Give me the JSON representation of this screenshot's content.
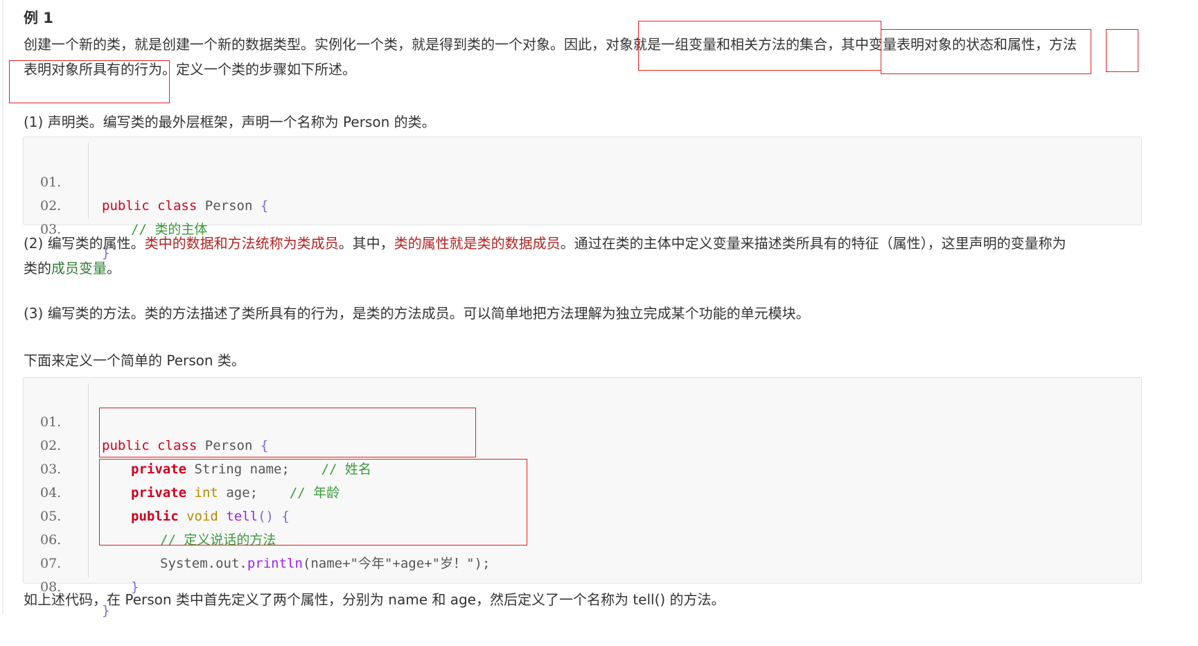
{
  "heading": "例 1",
  "intro": {
    "part1": "创建一个新的类，就是创建一个新的数据类型。实例化一个类，就是得到类的一个对象。因此，",
    "part2": "对象就是一组变量和相关方法的集合",
    "sep1": "，",
    "part3": "其中变量表明对象的状态和属性",
    "sep2": "，",
    "part4": "方法",
    "part5": "表明对象所具有的行为",
    "part6": "。定义一个类的步骤如下所述。"
  },
  "step1": "(1) 声明类。编写类的最外层框架，声明一个名称为 Person 的类。",
  "code1": {
    "line_numbers": [
      "01.",
      "02.",
      "03."
    ],
    "l1": {
      "kw1": "public",
      "kw2": "class",
      "name": "Person",
      "brace": "{"
    },
    "l2": {
      "comment": "// 类的主体"
    },
    "l3": {
      "brace": "}"
    }
  },
  "step2": {
    "a": "(2) 编写类的属性。",
    "b": "类中的数据和方法统称为类成员",
    "c": "。其中，",
    "d": "类的属性就是类的数据成员",
    "e": "。通过在类的主体中定义变量来描述类所具有的特征（属性），这里声明的变量称为",
    "f": "类的",
    "g": "成员变量",
    "h": "。"
  },
  "step3": "(3) 编写类的方法。类的方法描述了类所具有的行为，是类的方法成员。可以简单地把方法理解为独立完成某个功能的单元模块。",
  "define_text": "下面来定义一个简单的 Person 类。",
  "code2": {
    "line_numbers": [
      "01.",
      "02.",
      "03.",
      "04.",
      "05.",
      "06.",
      "07.",
      "08."
    ],
    "l1": {
      "kw1": "public",
      "kw2": "class",
      "name": "Person",
      "brace": "{"
    },
    "l2": {
      "kw": "private",
      "type": "String",
      "name": "name;",
      "comment": "// 姓名"
    },
    "l3": {
      "kw": "private",
      "type": "int",
      "name": "age;",
      "comment": "// 年龄"
    },
    "l4": {
      "kw": "public",
      "type": "void",
      "method": "tell",
      "paren": "()",
      "brace": "{"
    },
    "l5": {
      "comment": "// 定义说话的方法"
    },
    "l6": {
      "obj": "System.out.",
      "method": "println",
      "args": "(name+\"今年\"+age+\"岁！\");"
    },
    "l7": {
      "brace": "}"
    },
    "l8": {
      "brace": "}"
    }
  },
  "summary": "如上述代码，在 Person 类中首先定义了两个属性，分别为 name 和 age，然后定义了一个名称为 tell() 的方法。",
  "colors": {
    "highlight_border": "#e02020",
    "keyword": "#d2001f",
    "comment": "#3a9a3a",
    "method": "#a020f0",
    "type_int": "#b58900",
    "emphasis_red": "#b22222",
    "emphasis_green": "#2e7d32"
  }
}
